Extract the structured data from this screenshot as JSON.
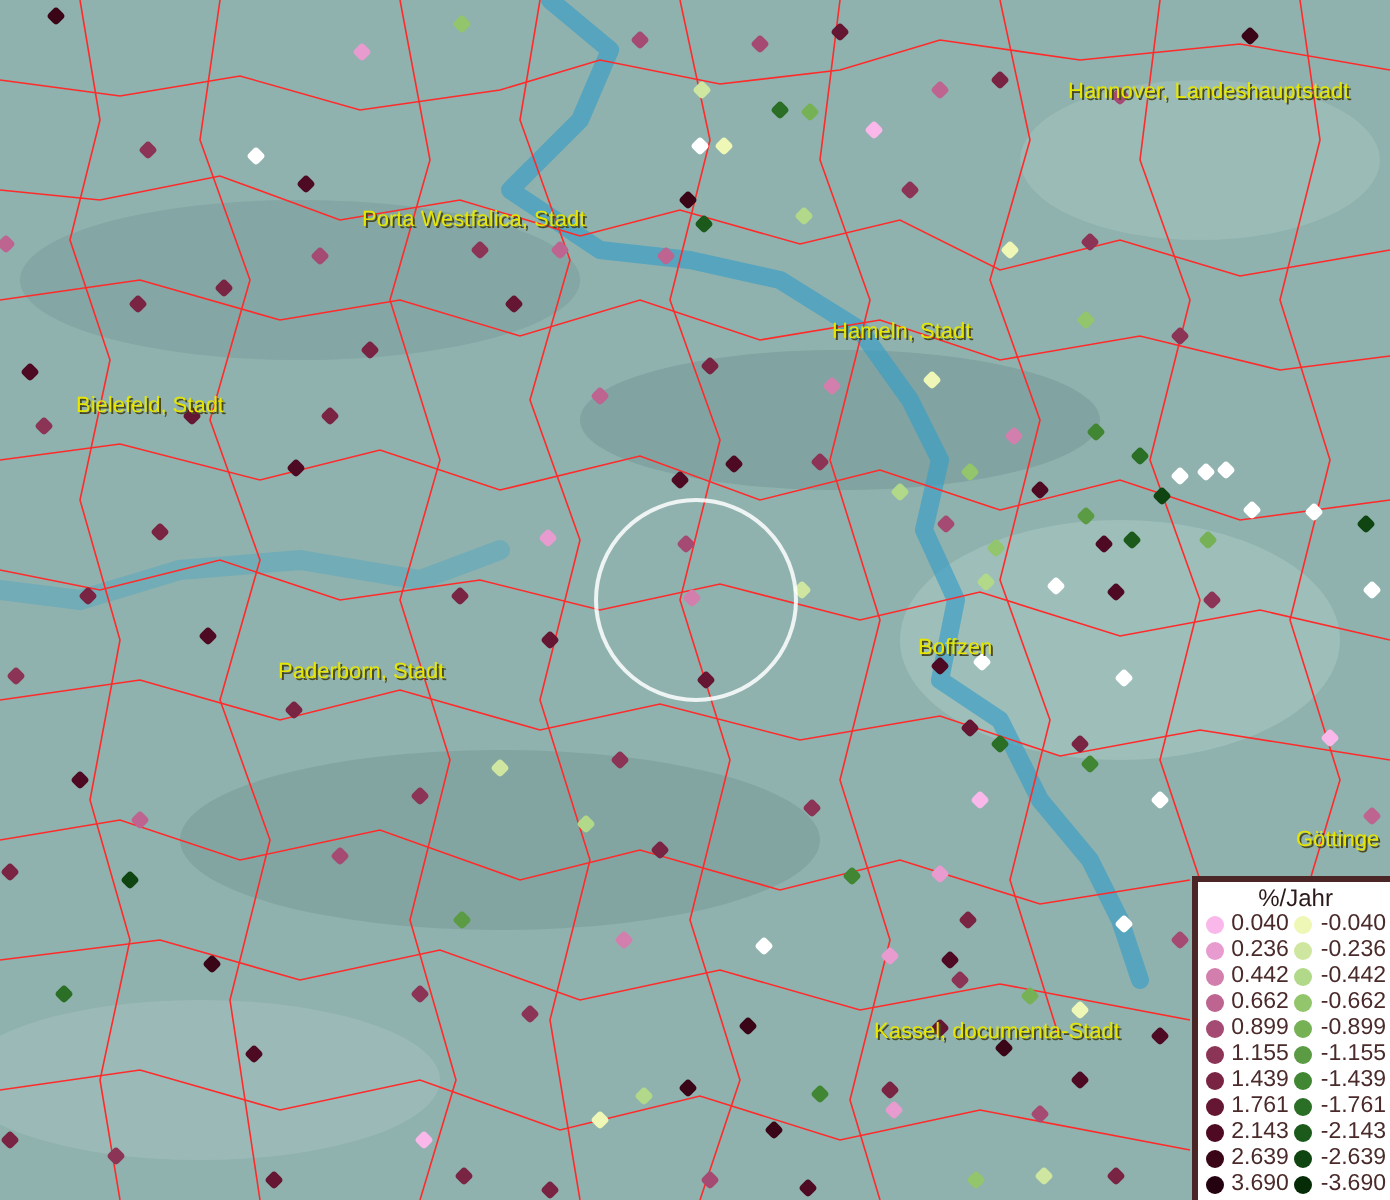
{
  "map": {
    "places": [
      {
        "name": "Hannover, Landeshauptstadt"
      },
      {
        "name": "Porta Westfalica, Stadt"
      },
      {
        "name": "Hameln, Stadt"
      },
      {
        "name": "Bielefeld, Stadt"
      },
      {
        "name": "Paderborn, Stadt"
      },
      {
        "name": "Boffzen"
      },
      {
        "name": "Göttinge"
      },
      {
        "name": "Kassel, documenta-Stadt"
      }
    ]
  },
  "legend": {
    "title": "%/Jahr",
    "positive": [
      {
        "label": "0.040",
        "color": "#f9b8e9"
      },
      {
        "label": "0.236",
        "color": "#e79bcf"
      },
      {
        "label": "0.442",
        "color": "#d37fae"
      },
      {
        "label": "0.662",
        "color": "#bd6490"
      },
      {
        "label": "0.899",
        "color": "#a54a72"
      },
      {
        "label": "1.155",
        "color": "#8c3455"
      },
      {
        "label": "1.439",
        "color": "#7a2443"
      },
      {
        "label": "1.761",
        "color": "#651632"
      },
      {
        "label": "2.143",
        "color": "#4d0a22"
      },
      {
        "label": "2.639",
        "color": "#3a0516"
      },
      {
        "label": "3.690",
        "color": "#250210"
      }
    ],
    "negative": [
      {
        "label": "-0.040",
        "color": "#eef7b5"
      },
      {
        "label": "-0.236",
        "color": "#cfe6a0"
      },
      {
        "label": "-0.442",
        "color": "#b2d98a"
      },
      {
        "label": "-0.662",
        "color": "#93c56c"
      },
      {
        "label": "-0.899",
        "color": "#76b255"
      },
      {
        "label": "-1.155",
        "color": "#5a9b43"
      },
      {
        "label": "-1.439",
        "color": "#418633"
      },
      {
        "label": "-1.761",
        "color": "#2b6e26"
      },
      {
        "label": "-2.143",
        "color": "#1b5a1a"
      },
      {
        "label": "-2.639",
        "color": "#0f4510"
      },
      {
        "label": "-3.690",
        "color": "#052c07"
      }
    ]
  }
}
